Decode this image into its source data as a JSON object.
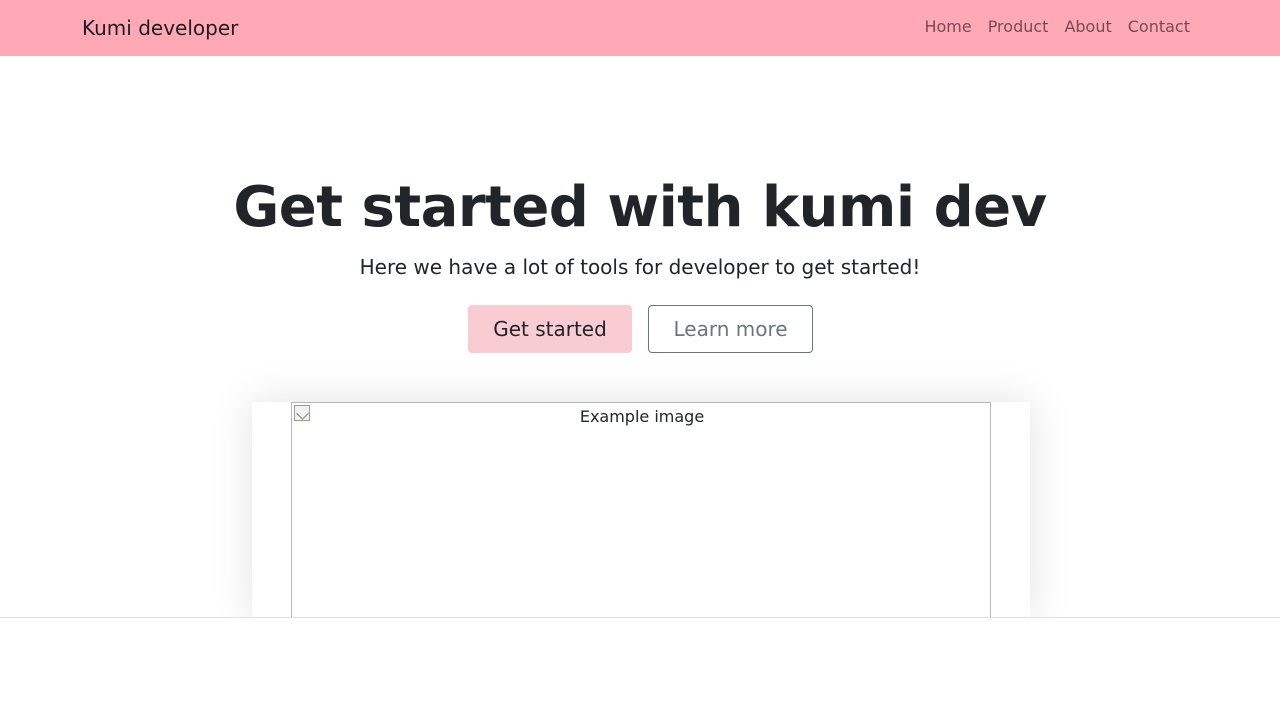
{
  "navbar": {
    "brand": "Kumi developer",
    "links": [
      "Home",
      "Product",
      "About",
      "Contact"
    ],
    "background": "#ffa8b6"
  },
  "hero": {
    "title": "Get started with kumi dev",
    "lead": "Here we have a lot of tools for developer to get started!",
    "primary_button": "Get started",
    "secondary_button": "Learn more",
    "primary_color": "#f9cbd2"
  },
  "image": {
    "alt": "Example image",
    "icon": "broken-image-icon"
  }
}
